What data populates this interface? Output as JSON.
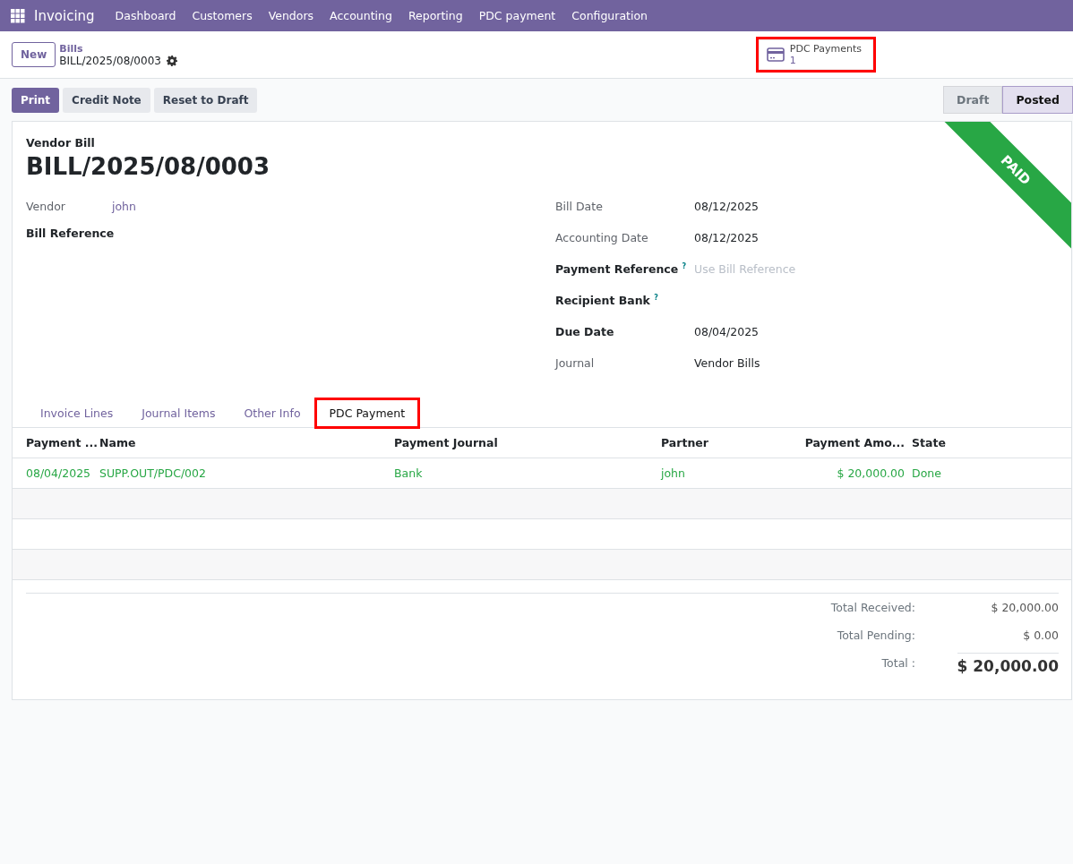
{
  "navbar": {
    "app": "Invoicing",
    "menus": [
      "Dashboard",
      "Customers",
      "Vendors",
      "Accounting",
      "Reporting",
      "PDC payment",
      "Configuration"
    ]
  },
  "control_panel": {
    "new_button": "New",
    "breadcrumb": "Bills",
    "record": "BILL/2025/08/0003",
    "smart_button": {
      "label": "PDC Payments",
      "count": "1",
      "highlighted": true
    }
  },
  "actions": [
    {
      "label": "Print",
      "primary": true
    },
    {
      "label": "Credit Note",
      "primary": false
    },
    {
      "label": "Reset to Draft",
      "primary": false
    }
  ],
  "statusbar": [
    {
      "label": "Draft",
      "selected": false
    },
    {
      "label": "Posted",
      "selected": true
    }
  ],
  "ribbon": "PAID",
  "form": {
    "type_label": "Vendor Bill",
    "name": "BILL/2025/08/0003",
    "left_fields": [
      {
        "label": "Vendor",
        "bold": false,
        "value": "john",
        "link": true
      },
      {
        "label": "Bill Reference",
        "bold": true
      }
    ],
    "right_fields": [
      {
        "label": "Bill Date",
        "bold": false,
        "value": "08/12/2025"
      },
      {
        "label": "Accounting Date",
        "bold": false,
        "value": "08/12/2025"
      },
      {
        "label": "Payment Reference $^{?}$",
        "bold": true,
        "placeholder": "Use Bill Reference"
      },
      {
        "label": "Recipient Bank $^{?}$",
        "bold": true
      },
      {
        "label": "Due Date",
        "bold": true,
        "value": "08/04/2025"
      },
      {
        "label": "Journal",
        "bold": false,
        "value": "Vendor Bills"
      }
    ]
  },
  "tabs": [
    {
      "label": "Invoice Lines",
      "selected": false,
      "highlighted": false
    },
    {
      "label": "Journal Items",
      "selected": false,
      "highlighted": false
    },
    {
      "label": "Other Info",
      "selected": false,
      "highlighted": false
    },
    {
      "label": "PDC Payment",
      "selected": true,
      "highlighted": true
    }
  ],
  "table": {
    "columns": [
      "Payment ...",
      "Name",
      "Payment Journal",
      "Partner",
      "Payment Amo...",
      "State"
    ],
    "rows": [
      [
        "08/04/2025",
        "SUPP.OUT/PDC/002",
        "Bank",
        "john",
        "$ 20,000.00",
        "Done"
      ]
    ]
  },
  "totals": [
    {
      "label": "Total Received:",
      "value": "$ 20,000.00",
      "grand": false
    },
    {
      "label": "Total Pending:",
      "value": "$ 0.00",
      "grand": false
    },
    {
      "label": "Total :",
      "value": "$ 20,000.00",
      "grand": true
    }
  ]
}
